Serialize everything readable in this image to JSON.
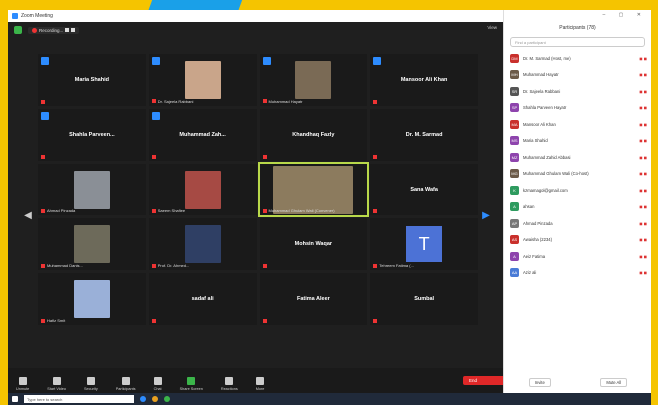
{
  "window": {
    "title": "Zoom Meeting"
  },
  "topbar": {
    "recording_label": "Recording...",
    "view_label": "View"
  },
  "tiles": [
    {
      "name": "Maria Shahid",
      "caption": "",
      "hand": true,
      "type": "name"
    },
    {
      "name": "",
      "caption": "Dr. Sajeela Rabbani",
      "hand": true,
      "type": "photo",
      "color": "#c9a58a"
    },
    {
      "name": "",
      "caption": "Muhammad Hayatr",
      "hand": true,
      "type": "photo",
      "color": "#7a6a55"
    },
    {
      "name": "Mansoor Ali Khan",
      "caption": "",
      "hand": true,
      "type": "name"
    },
    {
      "name": "Shahla Parveen...",
      "caption": "",
      "hand": true,
      "type": "name"
    },
    {
      "name": "Muhammad Zah...",
      "caption": "",
      "hand": true,
      "type": "name"
    },
    {
      "name": "Khandhaq Fazly",
      "caption": "",
      "hand": false,
      "type": "name"
    },
    {
      "name": "Dr. M. Sarmad",
      "caption": "",
      "hand": false,
      "type": "name"
    },
    {
      "name": "",
      "caption": "Ahmad Pinzada",
      "hand": false,
      "type": "photo",
      "color": "#8a8f96"
    },
    {
      "name": "",
      "caption": "Saeem Shafiee",
      "hand": false,
      "type": "photo",
      "color": "#a64a44"
    },
    {
      "name": "",
      "caption": "Muhammad Ghulam Wali (Convener)",
      "hand": false,
      "type": "photo",
      "color": "#8c7b5e",
      "active": true
    },
    {
      "name": "Sana Wafa",
      "caption": "",
      "hand": false,
      "type": "name"
    },
    {
      "name": "",
      "caption": "Muhammad Danis...",
      "hand": false,
      "type": "photo",
      "color": "#6d6a5a"
    },
    {
      "name": "",
      "caption": "Prof. Dr. Ahmed...",
      "hand": false,
      "type": "photo",
      "color": "#2f3f64"
    },
    {
      "name": "Mohsin Waqar",
      "caption": "",
      "hand": false,
      "type": "name"
    },
    {
      "name": "",
      "caption": "Tehreem Fatima (...",
      "hand": false,
      "type": "avatar",
      "letter": "T"
    },
    {
      "name": "",
      "caption": "Hafiz Smit",
      "hand": false,
      "type": "photo",
      "color": "#9ab0d8"
    },
    {
      "name": "sadaf ali",
      "caption": "",
      "hand": false,
      "type": "name"
    },
    {
      "name": "Fatima Aleer",
      "caption": "",
      "hand": false,
      "type": "name"
    },
    {
      "name": "Sumbal",
      "caption": "",
      "hand": false,
      "type": "name"
    }
  ],
  "toolbar": {
    "items": [
      "Unmute",
      "Start Video",
      "Security",
      "Participants",
      "Chat",
      "Share Screen",
      "Reactions",
      "More"
    ],
    "end_label": "End"
  },
  "panel": {
    "title": "Participants (78)",
    "search_placeholder": "Find a participant",
    "participants": [
      {
        "initials": "DM",
        "color": "#c9302c",
        "name": "Dr. M. Sarmad (Host, me)"
      },
      {
        "initials": "MH",
        "color": "#6b5a48",
        "name": "Muhammad Hayatr"
      },
      {
        "initials": "SR",
        "color": "#555",
        "name": "Dr. Sajeela Rabbani"
      },
      {
        "initials": "SP",
        "color": "#8e44ad",
        "name": "Shahla Parveen Hayatr"
      },
      {
        "initials": "MA",
        "color": "#c9302c",
        "name": "Mansoor Ali Khan"
      },
      {
        "initials": "MS",
        "color": "#8e44ad",
        "name": "Maria Shahid"
      },
      {
        "initials": "MZ",
        "color": "#8e44ad",
        "name": "Muhammad Zahid Abbasi"
      },
      {
        "initials": "MG",
        "color": "#6b5a48",
        "name": "Muhammad Ghulam Wali (Co-host)"
      },
      {
        "initials": "K",
        "color": "#2e9b5f",
        "name": "kzmamagol@gmail.com"
      },
      {
        "initials": "A",
        "color": "#2e9b5f",
        "name": "ahsan"
      },
      {
        "initials": "AP",
        "color": "#777",
        "name": "Ahmad Pinzada"
      },
      {
        "initials": "AS",
        "color": "#c9302c",
        "name": "Awaisha (2234)"
      },
      {
        "initials": "A",
        "color": "#8e44ad",
        "name": "Aeiz Fatima"
      },
      {
        "initials": "AA",
        "color": "#4a7bd6",
        "name": "Aziz ali"
      }
    ],
    "footer": [
      "Invite",
      "Mute All"
    ]
  },
  "taskbar": {
    "search_placeholder": "Type here to search"
  }
}
